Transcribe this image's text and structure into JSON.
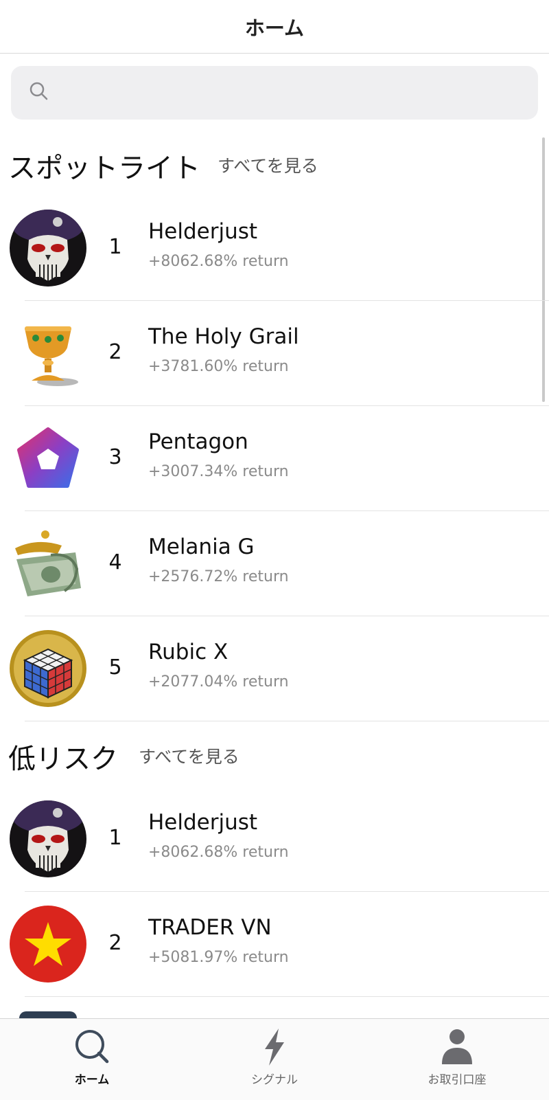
{
  "header": {
    "title": "ホーム"
  },
  "search": {
    "placeholder": ""
  },
  "spotlight": {
    "title": "スポットライト",
    "see_all": "すべてを見る",
    "items": [
      {
        "rank": "1",
        "name": "Helderjust",
        "return": "+8062.68% return"
      },
      {
        "rank": "2",
        "name": "The Holy Grail",
        "return": "+3781.60% return"
      },
      {
        "rank": "3",
        "name": "Pentagon",
        "return": "+3007.34% return"
      },
      {
        "rank": "4",
        "name": "Melania G",
        "return": "+2576.72% return"
      },
      {
        "rank": "5",
        "name": "Rubic X",
        "return": "+2077.04% return"
      }
    ]
  },
  "low_risk": {
    "title": "低リスク",
    "see_all": "すべてを見る",
    "items": [
      {
        "rank": "1",
        "name": "Helderjust",
        "return": "+8062.68% return"
      },
      {
        "rank": "2",
        "name": "TRADER VN",
        "return": "+5081.97% return"
      }
    ]
  },
  "tabbar": {
    "tabs": [
      {
        "label": "ホーム",
        "icon": "search-icon"
      },
      {
        "label": "シグナル",
        "icon": "lightning-icon"
      },
      {
        "label": "お取引口座",
        "icon": "person-icon"
      }
    ]
  }
}
